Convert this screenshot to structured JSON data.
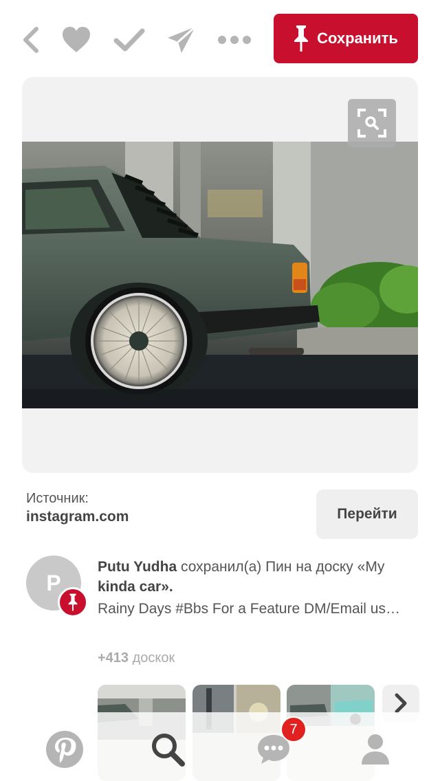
{
  "toolbar": {
    "back_icon": "chevron-left-icon",
    "like_icon": "heart-icon",
    "done_icon": "checkmark-icon",
    "send_icon": "paper-plane-icon",
    "more_icon": "ellipsis-icon",
    "save_label": "Сохранить"
  },
  "pin": {
    "zoom_icon": "visual-search-icon",
    "image_alt": "Grey BMW E30 with BBS wheels in the rain"
  },
  "source": {
    "label": "Источник:",
    "domain": "instagram.com",
    "go_label": "Перейти"
  },
  "attribution": {
    "avatar_letter": "P",
    "user_name": "Putu Yudha",
    "action_text": "сохранил(а) Пин на доску «My",
    "board_name": "kinda car",
    "board_suffix": "».",
    "description": "Rainy Days  #Bbs For a Feature DM/Email us…",
    "boards_count": "+413",
    "boards_label": "доскок"
  },
  "bottom_nav": {
    "home_icon": "pinterest-logo-icon",
    "search_icon": "search-icon",
    "messages_icon": "speech-bubble-icon",
    "notification_count": "7",
    "profile_icon": "person-icon"
  },
  "colors": {
    "brand_red": "#c8102e",
    "badge_red": "#e0211f",
    "icon_grey": "#b5b5b5"
  }
}
